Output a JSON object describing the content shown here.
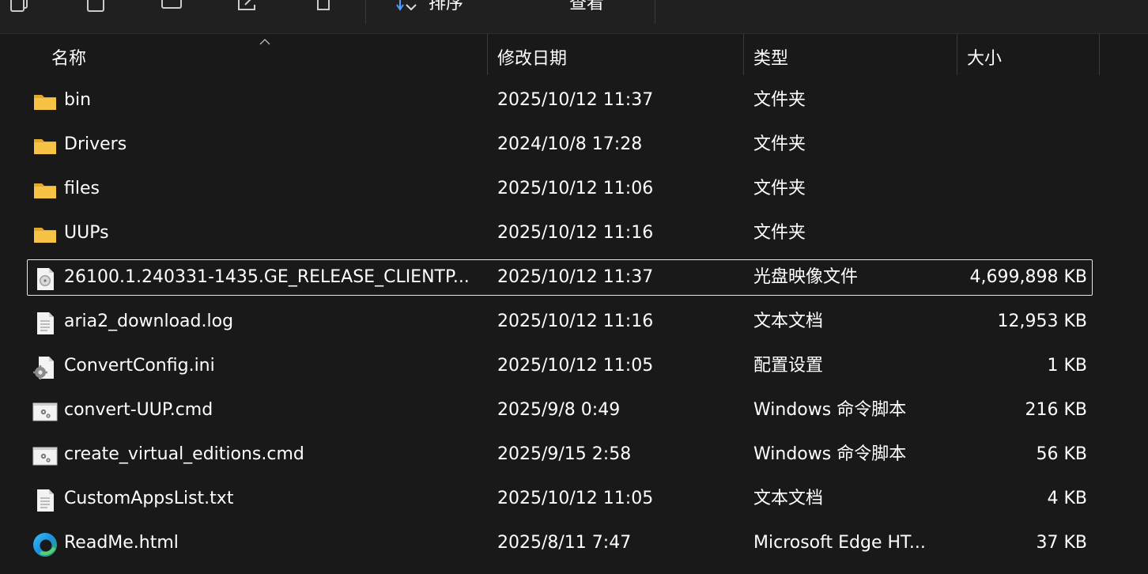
{
  "toolbar": {
    "sort_label": "排序",
    "view_label": "查看",
    "more_label": "···"
  },
  "columns": {
    "name": "名称",
    "date": "修改日期",
    "type": "类型",
    "size": "大小"
  },
  "files": [
    {
      "name": "bin",
      "date": "2025/10/12 11:37",
      "type": "文件夹",
      "size": "",
      "icon": "folder-icon"
    },
    {
      "name": "Drivers",
      "date": "2024/10/8 17:28",
      "type": "文件夹",
      "size": "",
      "icon": "folder-icon"
    },
    {
      "name": "files",
      "date": "2025/10/12 11:06",
      "type": "文件夹",
      "size": "",
      "icon": "folder-icon"
    },
    {
      "name": "UUPs",
      "date": "2025/10/12 11:16",
      "type": "文件夹",
      "size": "",
      "icon": "folder-icon"
    },
    {
      "name": "26100.1.240331-1435.GE_RELEASE_CLIENTP...",
      "date": "2025/10/12 11:37",
      "type": "光盘映像文件",
      "size": "4,699,898 KB",
      "icon": "disc-image-icon"
    },
    {
      "name": "aria2_download.log",
      "date": "2025/10/12 11:16",
      "type": "文本文档",
      "size": "12,953 KB",
      "icon": "text-file-icon"
    },
    {
      "name": "ConvertConfig.ini",
      "date": "2025/10/12 11:05",
      "type": "配置设置",
      "size": "1 KB",
      "icon": "config-file-icon"
    },
    {
      "name": "convert-UUP.cmd",
      "date": "2025/9/8 0:49",
      "type": "Windows 命令脚本",
      "size": "216 KB",
      "icon": "cmd-script-icon"
    },
    {
      "name": "create_virtual_editions.cmd",
      "date": "2025/9/15 2:58",
      "type": "Windows 命令脚本",
      "size": "56 KB",
      "icon": "cmd-script-icon"
    },
    {
      "name": "CustomAppsList.txt",
      "date": "2025/10/12 11:05",
      "type": "文本文档",
      "size": "4 KB",
      "icon": "text-file-icon"
    },
    {
      "name": "ReadMe.html",
      "date": "2025/8/11 7:47",
      "type": "Microsoft Edge HT...",
      "size": "37 KB",
      "icon": "edge-icon"
    }
  ],
  "selected_index": 4,
  "colors": {
    "background": "#191919",
    "toolbar": "#202020",
    "folder": "#f6c344",
    "text": "#ffffff",
    "selection_border": "#e6e6e6",
    "accent": "#4ea3ff"
  }
}
